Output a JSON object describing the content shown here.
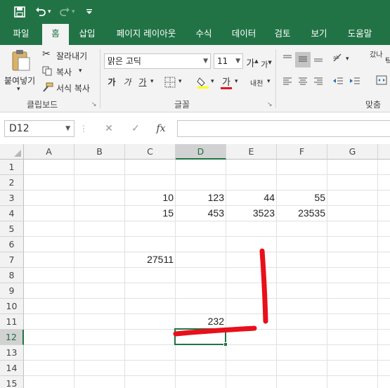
{
  "quick_access": {
    "save_icon": "save-icon",
    "undo_icon": "undo-icon",
    "redo_icon": "redo-icon",
    "customize_icon": "customize-qat-icon"
  },
  "tabs": [
    "파일",
    "홈",
    "삽입",
    "페이지 레이아웃",
    "수식",
    "데이터",
    "검토",
    "보기",
    "도움말"
  ],
  "active_tab": "홈",
  "ribbon": {
    "clipboard": {
      "paste_label": "붙여넣기",
      "cut_label": "잘라내기",
      "copy_label": "복사",
      "format_painter_label": "서식 복사",
      "group_label": "클립보드"
    },
    "font": {
      "font_name": "맑은 고딕",
      "font_size": "11",
      "grow_label": "가",
      "shrink_label": "가",
      "bold_label": "가",
      "italic_label": "가",
      "underline_label": "가",
      "font_color_label": "가",
      "phonetic_label": "내천",
      "group_label": "글꼴"
    },
    "alignment": {
      "wrap_label": "갔나",
      "group_label": "맞춤"
    }
  },
  "formula_bar": {
    "name_box": "D12",
    "cancel_icon": "✕",
    "enter_icon": "✓",
    "fx_label": "fx",
    "formula": ""
  },
  "grid": {
    "columns": [
      "A",
      "B",
      "C",
      "D",
      "E",
      "F",
      "G"
    ],
    "rows": [
      "1",
      "2",
      "3",
      "4",
      "5",
      "6",
      "7",
      "8",
      "9",
      "10",
      "11",
      "12",
      "13",
      "14",
      "15"
    ],
    "selected_column": "D",
    "selected_row": "12",
    "cells": [
      {
        "ref": "C3",
        "value": "10"
      },
      {
        "ref": "D3",
        "value": "123"
      },
      {
        "ref": "E3",
        "value": "44"
      },
      {
        "ref": "F3",
        "value": "55"
      },
      {
        "ref": "C4",
        "value": "15"
      },
      {
        "ref": "D4",
        "value": "453"
      },
      {
        "ref": "E4",
        "value": "3523"
      },
      {
        "ref": "F4",
        "value": "23535"
      },
      {
        "ref": "C7",
        "value": "27511"
      },
      {
        "ref": "D11",
        "value": "232"
      }
    ]
  },
  "annotation": {
    "color": "#e8101a",
    "description_icon": "red-hand-drawn-corner-mark"
  },
  "colors": {
    "brand_green": "#217346",
    "ribbon_bg": "#f3f3f3"
  }
}
